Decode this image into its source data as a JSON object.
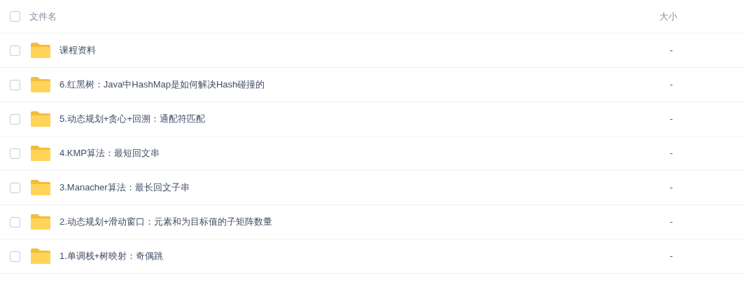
{
  "header": {
    "checked": false,
    "name": "文件名",
    "size": "大小"
  },
  "files": [
    {
      "name": "课程资料",
      "size": "-",
      "checked": false
    },
    {
      "name": "6.红黑树：Java中HashMap是如何解决Hash碰撞的",
      "size": "-",
      "checked": false
    },
    {
      "name": "5.动态规划+贪心+回溯：通配符匹配",
      "size": "-",
      "checked": false
    },
    {
      "name": "4.KMP算法：最短回文串",
      "size": "-",
      "checked": false
    },
    {
      "name": "3.Manacher算法：最长回文子串",
      "size": "-",
      "checked": false
    },
    {
      "name": "2.动态规划+滑动窗口：元素和为目标值的子矩阵数量",
      "size": "-",
      "checked": false
    },
    {
      "name": "1.单调栈+树映射：奇偶跳",
      "size": "-",
      "checked": false
    }
  ]
}
